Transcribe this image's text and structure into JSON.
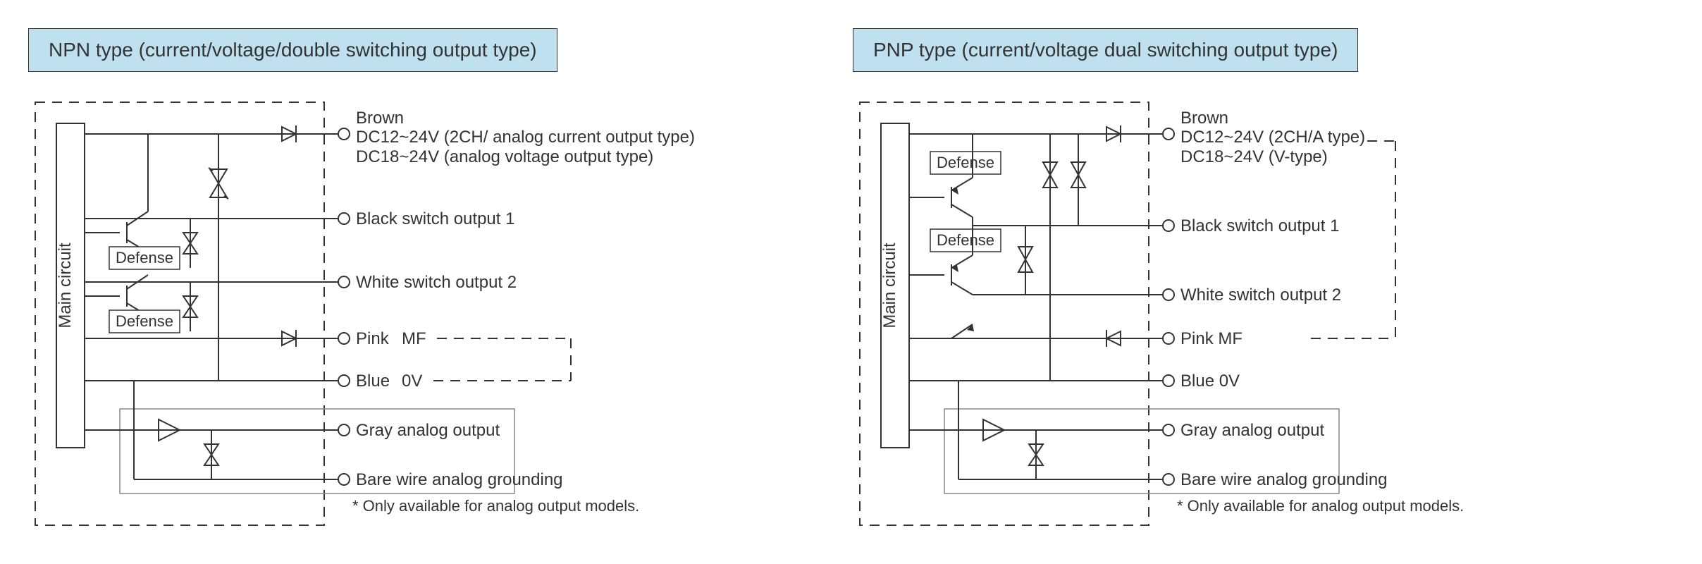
{
  "npn": {
    "title": "NPN type (current/voltage/double switching output type)",
    "main": "Main circuit",
    "defense": "Defense",
    "footnote": "* Only available for analog output models.",
    "brown_color": "Brown",
    "brown_line1": "DC12~24V (2CH/ analog current output type)",
    "brown_line2": "DC18~24V (analog voltage output type)",
    "black": "Black switch output 1",
    "white": "White switch output 2",
    "pink": "Pink",
    "pink_mf": "MF",
    "blue": "Blue",
    "blue_0v": "0V",
    "gray": "Gray analog output",
    "bare": "Bare wire analog grounding"
  },
  "pnp": {
    "title": "PNP type (current/voltage dual switching output type)",
    "main": "Main circuit",
    "defense": "Defense",
    "footnote": "* Only available for analog output models.",
    "brown_color": "Brown",
    "brown_line1": "DC12~24V (2CH/A type)",
    "brown_line2": "DC18~24V (V-type)",
    "black": "Black switch output 1",
    "white": "White switch output 2",
    "pink": "Pink MF",
    "blue": "Blue 0V",
    "gray": "Gray analog output",
    "bare": "Bare wire analog grounding"
  }
}
